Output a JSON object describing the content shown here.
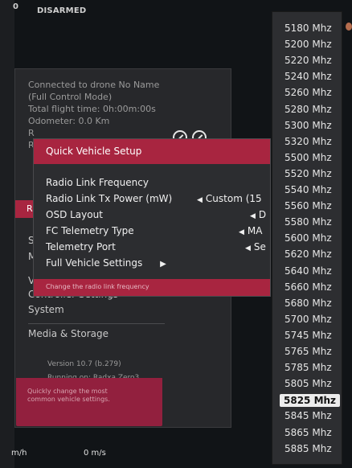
{
  "top": {
    "zero": "0",
    "armed_state": "DISARMED"
  },
  "info": {
    "line1": "Connected to drone No Name",
    "line2": "(Full Control Mode)",
    "line3": "Total flight time: 0h:00m:00s",
    "line4": "Odometer: 0.0 Km",
    "stub1": "R",
    "stub2": "R"
  },
  "left_menu": {
    "stub_r": "R",
    "stub_s": "S",
    "stub_m": "M",
    "stub_v": "V",
    "controller_settings": "Controller Settings",
    "system": "System",
    "media": "Media & Storage",
    "version": "Version 10.7 (b.279)",
    "running": "Running on: Radxa Zero3",
    "help_line1": "Quickly change the most",
    "help_line2": "common vehicle settings."
  },
  "quick_setup": {
    "header": "Quick Vehicle Setup",
    "items": [
      {
        "label": "Radio Link Frequency",
        "value": ""
      },
      {
        "label": "Radio Link Tx Power (mW)",
        "value": "Custom (15"
      },
      {
        "label": "OSD Layout",
        "value": "D"
      },
      {
        "label": "FC Telemetry Type",
        "value": "MA"
      },
      {
        "label": "Telemetry Port",
        "value": "Se"
      },
      {
        "label": "Full Vehicle Settings",
        "value": "▶"
      }
    ],
    "footer": "Change the radio link frequency"
  },
  "frequencies": {
    "items": [
      "5180 Mhz",
      "5200 Mhz",
      "5220 Mhz",
      "5240 Mhz",
      "5260 Mhz",
      "5280 Mhz",
      "5300 Mhz",
      "5320 Mhz",
      "5500 Mhz",
      "5520 Mhz",
      "5540 Mhz",
      "5560 Mhz",
      "5580 Mhz",
      "5600 Mhz",
      "5620 Mhz",
      "5640 Mhz",
      "5660 Mhz",
      "5680 Mhz",
      "5700 Mhz",
      "5745 Mhz",
      "5765 Mhz",
      "5785 Mhz",
      "5805 Mhz",
      "5825 Mhz",
      "5845 Mhz",
      "5865 Mhz",
      "5885 Mhz"
    ],
    "selected": "5825 Mhz"
  },
  "hud": {
    "speed_unit_left": "m/h",
    "speed_vertical": "0 m/s"
  }
}
